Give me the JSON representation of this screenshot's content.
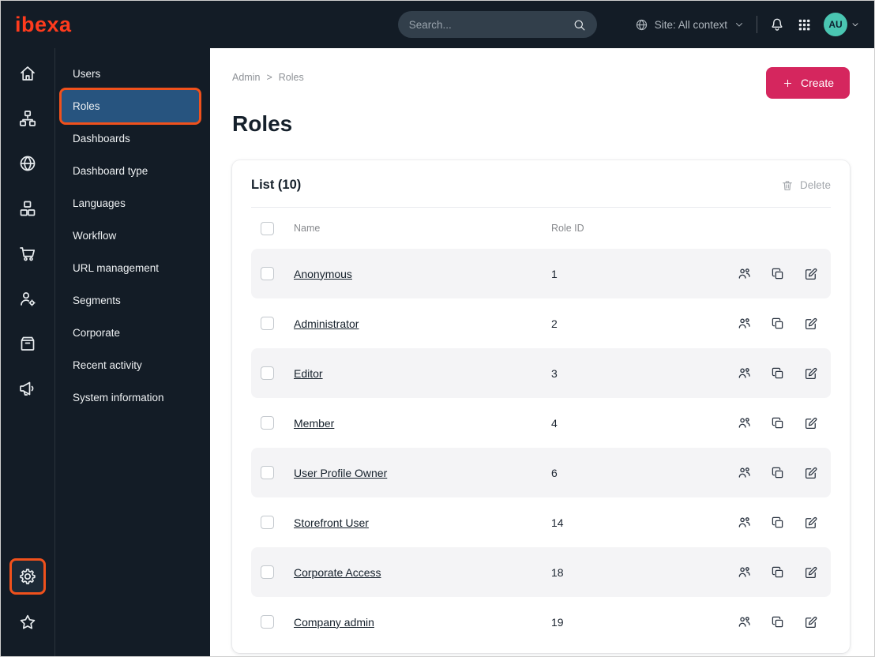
{
  "topbar": {
    "logo": "ibexa",
    "search_placeholder": "Search...",
    "site_selector": "Site: All context",
    "avatar": "AU"
  },
  "iconrail": {
    "top": [
      "home",
      "content-tree",
      "globe",
      "product-catalog",
      "commerce-cart",
      "customer-portal",
      "order-box",
      "campaign-megaphone"
    ],
    "bottom": [
      "settings-gear",
      "bookmarks-star"
    ],
    "highlighted": "settings-gear"
  },
  "sidebar": {
    "items": [
      "Users",
      "Roles",
      "Dashboards",
      "Dashboard type",
      "Languages",
      "Workflow",
      "URL management",
      "Segments",
      "Corporate",
      "Recent activity",
      "System information"
    ],
    "selected": "Roles"
  },
  "main": {
    "breadcrumb": [
      "Admin",
      "Roles"
    ],
    "breadcrumb_separator": ">",
    "create_label": "Create",
    "title": "Roles",
    "list": {
      "heading": "List (10)",
      "delete_label": "Delete",
      "columns": [
        "Name",
        "Role ID"
      ],
      "rows": [
        {
          "name": "Anonymous",
          "role_id": "1"
        },
        {
          "name": "Administrator",
          "role_id": "2"
        },
        {
          "name": "Editor",
          "role_id": "3"
        },
        {
          "name": "Member",
          "role_id": "4"
        },
        {
          "name": "User Profile Owner",
          "role_id": "6"
        },
        {
          "name": "Storefront User",
          "role_id": "14"
        },
        {
          "name": "Corporate Access",
          "role_id": "18"
        },
        {
          "name": "Company admin",
          "role_id": "19"
        }
      ]
    }
  },
  "colors": {
    "topbar_bg": "#131c26",
    "brand_orange": "#ff3b1d",
    "highlight_orange": "#f0511c",
    "create_button": "#d5265e",
    "selected_blue": "#27547f",
    "avatar_teal": "#4ac6b2"
  }
}
